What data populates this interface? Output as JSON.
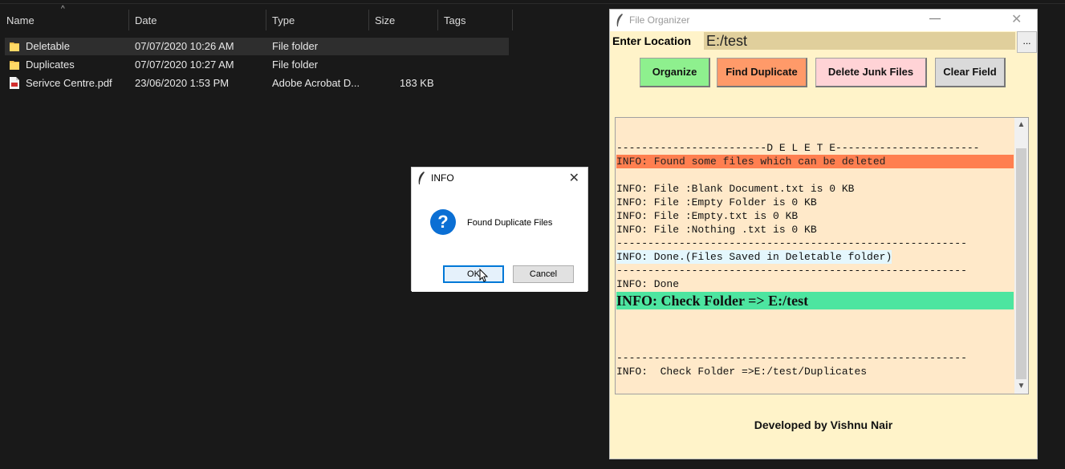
{
  "explorer": {
    "columns": {
      "name": "Name",
      "date": "Date",
      "type": "Type",
      "size": "Size",
      "tags": "Tags"
    },
    "rows": [
      {
        "name": "Deletable",
        "date": "07/07/2020 10:26 AM",
        "type": "File folder",
        "size": "",
        "icon": "folder-icon"
      },
      {
        "name": "Duplicates",
        "date": "07/07/2020 10:27 AM",
        "type": "File folder",
        "size": "",
        "icon": "folder-icon"
      },
      {
        "name": "Serivce Centre.pdf",
        "date": "23/06/2020 1:53 PM",
        "type": "Adobe Acrobat D...",
        "size": "183 KB",
        "icon": "pdf-icon"
      }
    ]
  },
  "info_dialog": {
    "title": "INFO",
    "message": "Found Duplicate Files",
    "ok_label": "OK",
    "cancel_label": "Cancel",
    "icon": "question-icon"
  },
  "organizer": {
    "title": "File Organizer",
    "location_label": "Enter Location",
    "location_value": "E:/test",
    "browse_label": "...",
    "buttons": {
      "organize": "Organize",
      "find_duplicate": "Find Duplicate",
      "delete_junk": "Delete Junk Files",
      "clear_field": "Clear Field"
    },
    "log": {
      "delete_header": "------------------------D E L E T E-----------------------",
      "found": "INFO: Found some files which can be deleted",
      "file1": "INFO: File :Blank Document.txt is 0 KB",
      "file2": "INFO: File :Empty Folder is 0 KB",
      "file3": "INFO: File :Empty.txt is 0 KB",
      "file4": "INFO: File :Nothing .txt is 0 KB",
      "separator": "--------------------------------------------------------",
      "done_saved": "INFO: Done.(Files Saved in Deletable folder)",
      "done": "INFO: Done",
      "check_folder": "INFO: Check Folder => E:/test",
      "check_duplicates": "INFO:  Check Folder =>E:/test/Duplicates"
    },
    "credit": "Developed by Vishnu Nair"
  },
  "colors": {
    "organize": "#8ef08e",
    "find_duplicate": "#ff9a69",
    "delete_junk": "#ffd3d6",
    "clear_field": "#dadada",
    "found_highlight": "#ff7f50",
    "check_highlight": "#4de5a0"
  }
}
